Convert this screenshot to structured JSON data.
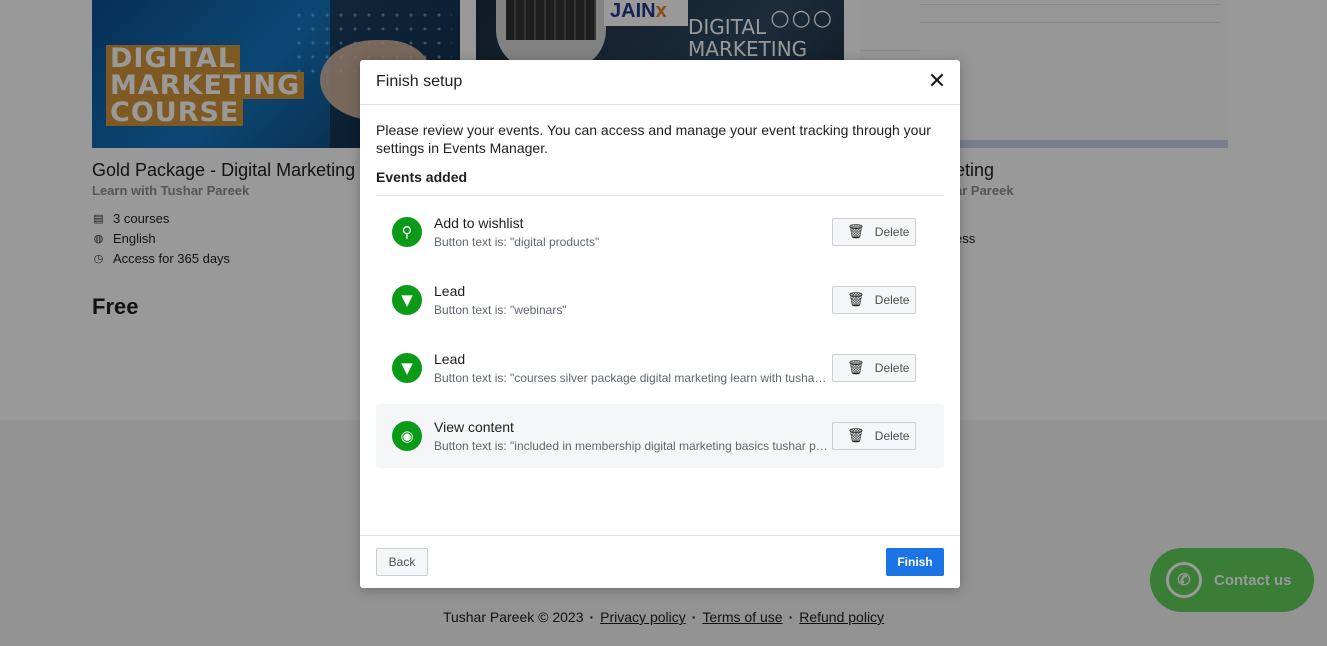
{
  "background": {
    "card1": {
      "image_words": [
        "DIGITAL",
        "MARKETING",
        "COURSE"
      ],
      "title": "Gold Package - Digital Marketing",
      "subtitle": "Learn with Tushar Pareek",
      "meta": [
        {
          "icon": "book-icon",
          "text": "3 courses"
        },
        {
          "icon": "globe-icon",
          "text": "English"
        },
        {
          "icon": "clock-icon",
          "text": "Access for 365 days"
        }
      ],
      "price": "Free"
    },
    "card2": {
      "brand": "JAIN",
      "brand_suffix": "x",
      "image_text": [
        "DIGITAL",
        "MARKETING"
      ]
    },
    "card3": {
      "title_partial": "eting",
      "subtitle_partial": "ar Pareek",
      "meta_partial": "ess"
    }
  },
  "footer": {
    "copyright": "Tushar Pareek © 2023",
    "links": [
      "Privacy policy",
      "Terms of use",
      "Refund policy"
    ]
  },
  "contact": {
    "label": "Contact us",
    "icon": "whatsapp-icon"
  },
  "modal": {
    "title": "Finish setup",
    "intro": "Please review your events. You can access and manage your event tracking through your settings in Events Manager.",
    "section_heading": "Events added",
    "delete_label": "Delete",
    "events": [
      {
        "icon": "magic-wand-icon",
        "name": "Add to wishlist",
        "desc": "Button text is: \"digital products\""
      },
      {
        "icon": "funnel-icon",
        "name": "Lead",
        "desc": "Button text is: \"webinars\""
      },
      {
        "icon": "funnel-icon",
        "name": "Lead",
        "desc": "Button text is: \"courses silver package digital marketing learn with tushar pareek\""
      },
      {
        "icon": "eye-icon",
        "name": "View content",
        "desc": "Button text is: \"included in membership digital marketing basics tushar pareek\""
      }
    ],
    "back_label": "Back",
    "finish_label": "Finish",
    "accent_color": "#1b74e4",
    "event_icon_color": "#0a9a16"
  }
}
